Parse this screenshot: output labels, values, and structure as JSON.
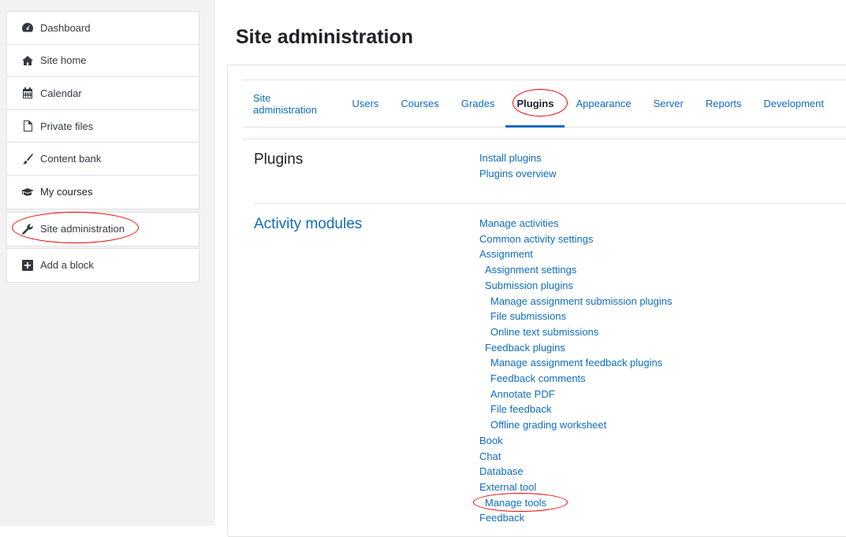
{
  "sidebar": {
    "nav": [
      {
        "label": "Dashboard",
        "icon": "dashboard-icon"
      },
      {
        "label": "Site home",
        "icon": "home-icon"
      },
      {
        "label": "Calendar",
        "icon": "calendar-icon"
      },
      {
        "label": "Private files",
        "icon": "file-icon"
      },
      {
        "label": "Content bank",
        "icon": "paintbrush-icon"
      },
      {
        "label": "My courses",
        "icon": "graduation-cap-icon"
      }
    ],
    "site_admin": {
      "label": "Site administration",
      "icon": "wrench-icon"
    },
    "add_block": {
      "label": "Add a block",
      "icon": "plus-square-icon"
    }
  },
  "header": {
    "title": "Site administration"
  },
  "tabs": [
    "Site administration",
    "Users",
    "Courses",
    "Grades",
    "Plugins",
    "Appearance",
    "Server",
    "Reports",
    "Development"
  ],
  "active_tab": "Plugins",
  "sections": [
    {
      "heading": "Plugins",
      "links": [
        {
          "label": "Install plugins",
          "level": 0
        },
        {
          "label": "Plugins overview",
          "level": 0
        }
      ]
    },
    {
      "heading": "Activity modules",
      "links": [
        {
          "label": "Manage activities",
          "level": 0
        },
        {
          "label": "Common activity settings",
          "level": 0
        },
        {
          "label": "Assignment",
          "level": 0
        },
        {
          "label": "Assignment settings",
          "level": 1
        },
        {
          "label": "Submission plugins",
          "level": 1
        },
        {
          "label": "Manage assignment submission plugins",
          "level": 2
        },
        {
          "label": "File submissions",
          "level": 2
        },
        {
          "label": "Online text submissions",
          "level": 2
        },
        {
          "label": "Feedback plugins",
          "level": 1
        },
        {
          "label": "Manage assignment feedback plugins",
          "level": 2
        },
        {
          "label": "Feedback comments",
          "level": 2
        },
        {
          "label": "Annotate PDF",
          "level": 2
        },
        {
          "label": "File feedback",
          "level": 2
        },
        {
          "label": "Offline grading worksheet",
          "level": 2
        },
        {
          "label": "Book",
          "level": 0
        },
        {
          "label": "Chat",
          "level": 0
        },
        {
          "label": "Database",
          "level": 0
        },
        {
          "label": "External tool",
          "level": 0
        },
        {
          "label": "Manage tools",
          "level": 1
        },
        {
          "label": "Feedback",
          "level": 0
        }
      ]
    }
  ],
  "colors": {
    "link": "#0f6cbf",
    "annotation": "#e00000"
  }
}
